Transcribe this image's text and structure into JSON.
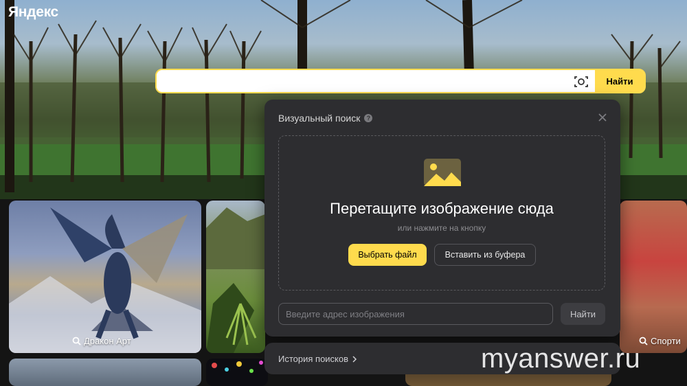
{
  "header": {
    "logo": "Яндекс"
  },
  "search": {
    "value": "",
    "placeholder": "",
    "button_label": "Найти"
  },
  "visual_search": {
    "title": "Визуальный поиск",
    "drop_title": "Перетащите изображение сюда",
    "drop_subtitle": "или нажмите на кнопку",
    "choose_file_label": "Выбрать файл",
    "paste_label": "Вставить из буфера",
    "url_placeholder": "Введите адрес изображения",
    "url_button_label": "Найти"
  },
  "history": {
    "label": "История поисков"
  },
  "cards": [
    {
      "label": "Дракон Арт"
    },
    {
      "label": "Спорти"
    }
  ],
  "watermark": "myanswer.ru",
  "colors": {
    "accent": "#ffdb4d",
    "panel": "#2d2d30"
  }
}
